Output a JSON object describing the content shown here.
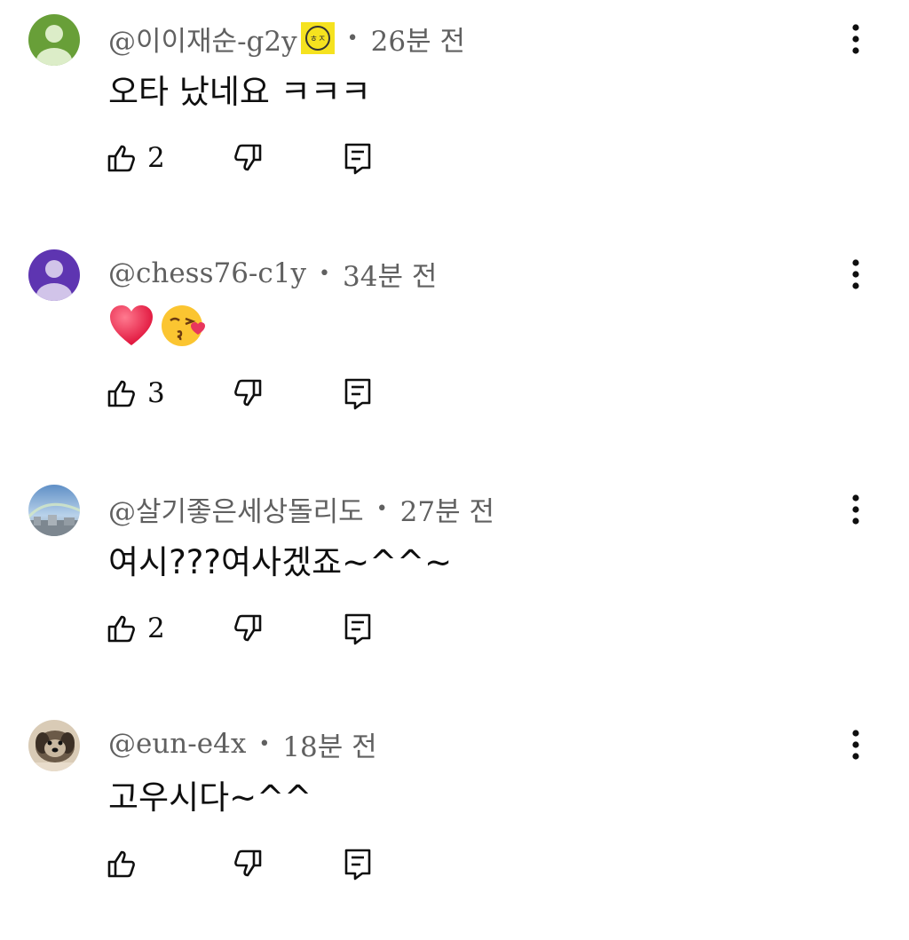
{
  "comments": [
    {
      "handle": "@이이재순-g2y",
      "time": "26분 전",
      "text": "오타  났네요 ㅋㅋㅋ",
      "likes": "2",
      "avatar_color": "#689f38",
      "badge": true
    },
    {
      "handle": "@chess76-c1y",
      "time": "34분 전",
      "text": "",
      "emojis": [
        "heart-emoji",
        "kissing-face-emoji"
      ],
      "likes": "3",
      "avatar_color": "#5e35b1",
      "badge": false
    },
    {
      "handle": "@살기좋은세상돌리도",
      "time": "27분 전",
      "text": "여시???여사겠죠~^^~",
      "likes": "2",
      "avatar_color": "#8fb7d8",
      "badge": false
    },
    {
      "handle": "@eun-e4x",
      "time": "18분 전",
      "text": "고우시다~^^",
      "likes": "",
      "avatar_color": "#7a6a5a",
      "badge": false
    }
  ],
  "separator": "•",
  "icons": {
    "like": "thumbs-up-icon",
    "dislike": "thumbs-down-icon",
    "reply": "reply-icon",
    "more": "more-vertical-icon"
  }
}
